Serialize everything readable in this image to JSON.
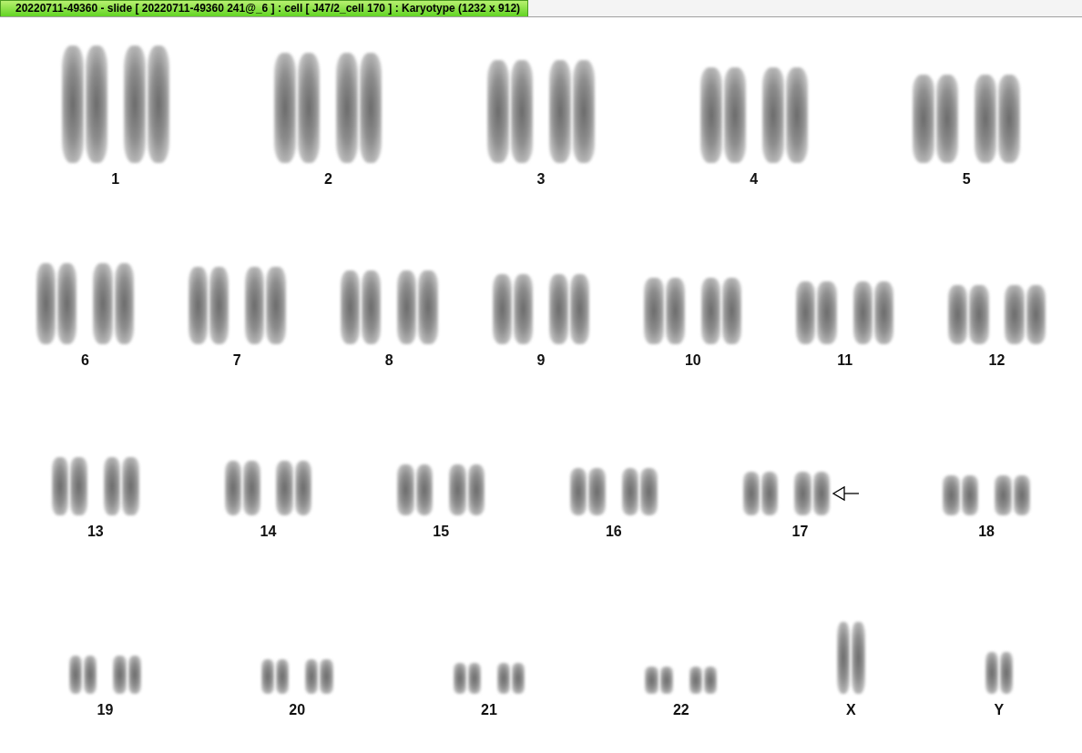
{
  "window": {
    "title": "20220711-49360 - slide [ 20220711-49360 241@_6 ] : cell [ J47/2_cell 170 ] : Karyotype  (1232 x 912)"
  },
  "karyotype": {
    "rows": [
      {
        "chromosomes": [
          {
            "label": "1",
            "kind": "pair",
            "marked": false
          },
          {
            "label": "2",
            "kind": "pair",
            "marked": false
          },
          {
            "label": "3",
            "kind": "pair",
            "marked": false
          },
          {
            "label": "4",
            "kind": "pair",
            "marked": false
          },
          {
            "label": "5",
            "kind": "pair",
            "marked": false
          }
        ]
      },
      {
        "chromosomes": [
          {
            "label": "6",
            "kind": "pair",
            "marked": false
          },
          {
            "label": "7",
            "kind": "pair",
            "marked": false
          },
          {
            "label": "8",
            "kind": "pair",
            "marked": false
          },
          {
            "label": "9",
            "kind": "pair",
            "marked": false
          },
          {
            "label": "10",
            "kind": "pair",
            "marked": false
          },
          {
            "label": "11",
            "kind": "pair",
            "marked": false
          },
          {
            "label": "12",
            "kind": "pair",
            "marked": false
          }
        ]
      },
      {
        "chromosomes": [
          {
            "label": "13",
            "kind": "pair",
            "marked": false
          },
          {
            "label": "14",
            "kind": "pair",
            "marked": false
          },
          {
            "label": "15",
            "kind": "pair",
            "marked": false
          },
          {
            "label": "16",
            "kind": "pair",
            "marked": false
          },
          {
            "label": "17",
            "kind": "pair",
            "marked": true
          },
          {
            "label": "18",
            "kind": "pair",
            "marked": false
          }
        ]
      },
      {
        "chromosomes": [
          {
            "label": "19",
            "kind": "pair",
            "marked": false
          },
          {
            "label": "20",
            "kind": "pair",
            "marked": false
          },
          {
            "label": "21",
            "kind": "pair",
            "marked": false
          },
          {
            "label": "22",
            "kind": "pair",
            "marked": false
          },
          {
            "label": "X",
            "kind": "single",
            "marked": false
          },
          {
            "label": "Y",
            "kind": "single",
            "marked": false
          }
        ]
      }
    ]
  }
}
